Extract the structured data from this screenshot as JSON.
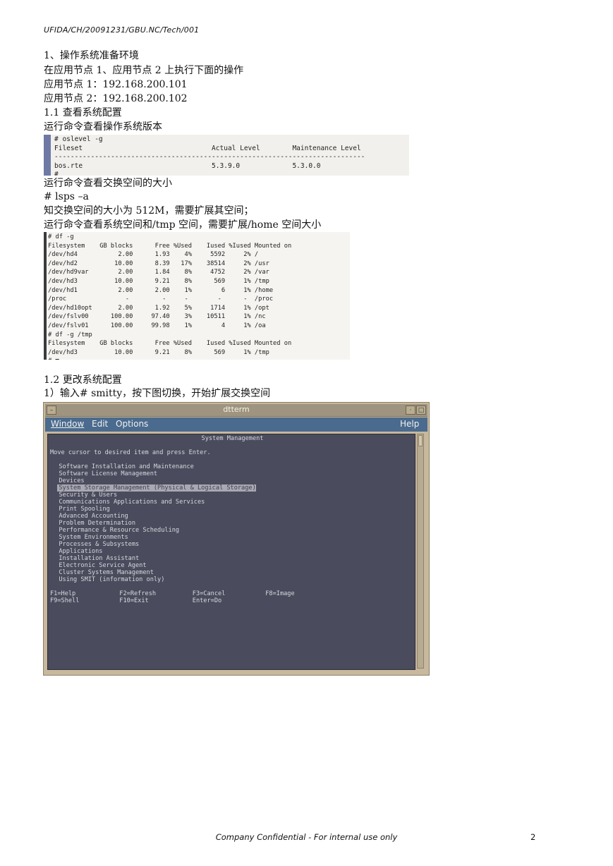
{
  "header": "UFIDA/CH/20091231/GBU.NC/Tech/001",
  "lines": {
    "l1": "1、操作系统准备环境",
    "l2": "在应用节点 1、应用节点 2 上执行下面的操作",
    "l3": "应用节点 1：192.168.200.101",
    "l4": "应用节点 2：192.168.200.102",
    "l5": "1.1 查看系统配置",
    "l6": "运行命令查看操作系统版本",
    "l7": "运行命令查看交换空间的大小",
    "l8": "# lsps –a",
    "l9": "知交换空间的大小为 512M，需要扩展其空间；",
    "l10": "运行命令查看系统空间和/tmp 空间，需要扩展/home 空间大小",
    "l11": "1.2 更改系统配置",
    "l12": "1）输入# smitty，按下图切换，开始扩展交换空间"
  },
  "oslevel": {
    "text": "# oslevel -g\nFileset                                Actual Level        Maintenance Level\n-----------------------------------------------------------------------------\nbos.rte                                5.3.9.0             5.3.0.0\n#"
  },
  "df": {
    "text": "# df -g\nFilesystem    GB blocks      Free %Used    Iused %Iused Mounted on\n/dev/hd4           2.00      1.93    4%     5592     2% /\n/dev/hd2          10.00      8.39   17%    38514     2% /usr\n/dev/hd9var        2.00      1.84    8%     4752     2% /var\n/dev/hd3          10.00      9.21    8%      569     1% /tmp\n/dev/hd1           2.00      2.00    1%        6     1% /home\n/proc                -         -     -        -      -  /proc\n/dev/hd10opt       2.00      1.92    5%     1714     1% /opt\n/dev/fslv00      100.00     97.40    3%    10511     1% /nc\n/dev/fslv01      100.00     99.98    1%        4     1% /oa\n# df -g /tmp\nFilesystem    GB blocks      Free %Used    Iused %Iused Mounted on\n/dev/hd3          10.00      9.21    8%      569     1% /tmp\n# ■"
  },
  "dtterm": {
    "title": "dtterm",
    "menu": {
      "window": "Window",
      "edit": "Edit",
      "options": "Options",
      "help": "Help"
    },
    "screen_title": "System Management",
    "prompt": "Move cursor to desired item and press Enter.",
    "items": [
      "Software Installation and Maintenance",
      "Software License Management",
      "Devices",
      "System Storage Management (Physical & Logical Storage)",
      "Security & Users",
      "Communications Applications and Services",
      "Print Spooling",
      "Advanced Accounting",
      "Problem Determination",
      "Performance & Resource Scheduling",
      "System Environments",
      "Processes & Subsystems",
      "Applications",
      "Installation Assistant",
      "Electronic Service Agent",
      "Cluster Systems Management",
      "Using SMIT (information only)"
    ],
    "selected_index": 3,
    "keys_row1": "F1=Help            F2=Refresh          F3=Cancel           F8=Image",
    "keys_row2": "F9=Shell           F10=Exit            Enter=Do"
  },
  "footer": "Company Confidential - For internal use only",
  "page_number": "2"
}
